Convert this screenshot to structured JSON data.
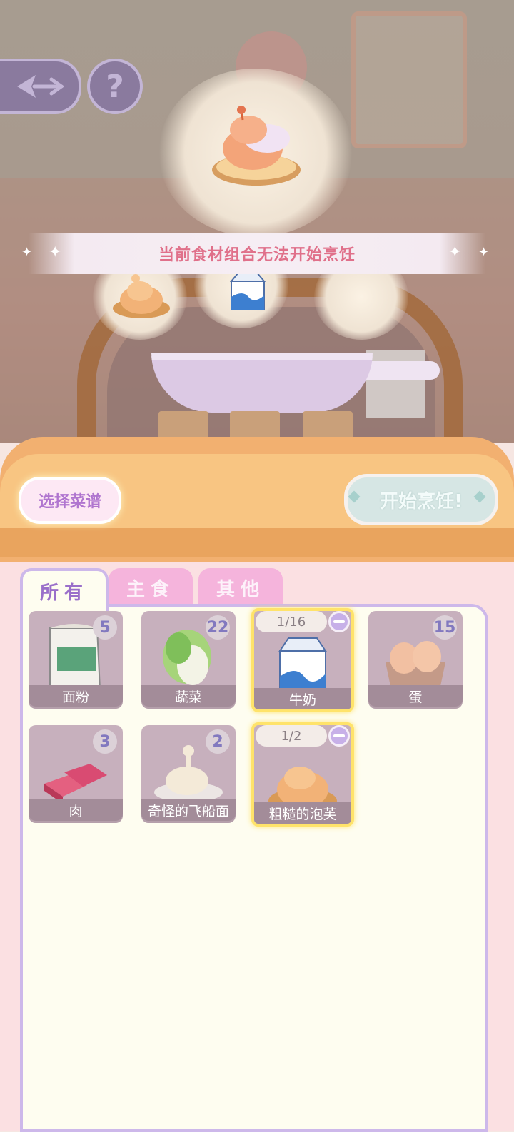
{
  "hud": {
    "back_icon": "arrow-left-icon",
    "help_label": "?"
  },
  "toast": {
    "message": "当前食材组合无法开始烹饪"
  },
  "target_dish": {
    "icon": "cream-puff-icon"
  },
  "pan_slots": [
    {
      "icon": "rough-puff-icon"
    },
    {
      "icon": "milk-carton-icon"
    },
    {
      "icon": "empty-slot"
    }
  ],
  "buttons": {
    "select_recipe": "选择菜谱",
    "start_cooking": "开始烹饪!"
  },
  "tabs": [
    {
      "label": "所有",
      "active": true
    },
    {
      "label": "主食",
      "active": false
    },
    {
      "label": "其他",
      "active": false
    }
  ],
  "ingredients": [
    {
      "name": "面粉",
      "count": "5",
      "icon": "flour-bag-icon"
    },
    {
      "name": "蔬菜",
      "count": "22",
      "icon": "cabbage-icon"
    },
    {
      "name": "牛奶",
      "selected": "1/16",
      "icon": "milk-carton-icon"
    },
    {
      "name": "蛋",
      "count": "15",
      "icon": "egg-tray-icon"
    },
    {
      "name": "肉",
      "count": "3",
      "icon": "meat-icon"
    },
    {
      "name": "奇怪的飞船面",
      "count": "2",
      "icon": "strange-noodle-icon"
    },
    {
      "name": "粗糙的泡芙",
      "selected": "1/2",
      "icon": "rough-puff-icon"
    }
  ],
  "colors": {
    "accent_purple": "#9a6fca",
    "toast_text": "#e0708a",
    "selected_border": "#ffe36a",
    "panel_orange": "#f2b070"
  }
}
